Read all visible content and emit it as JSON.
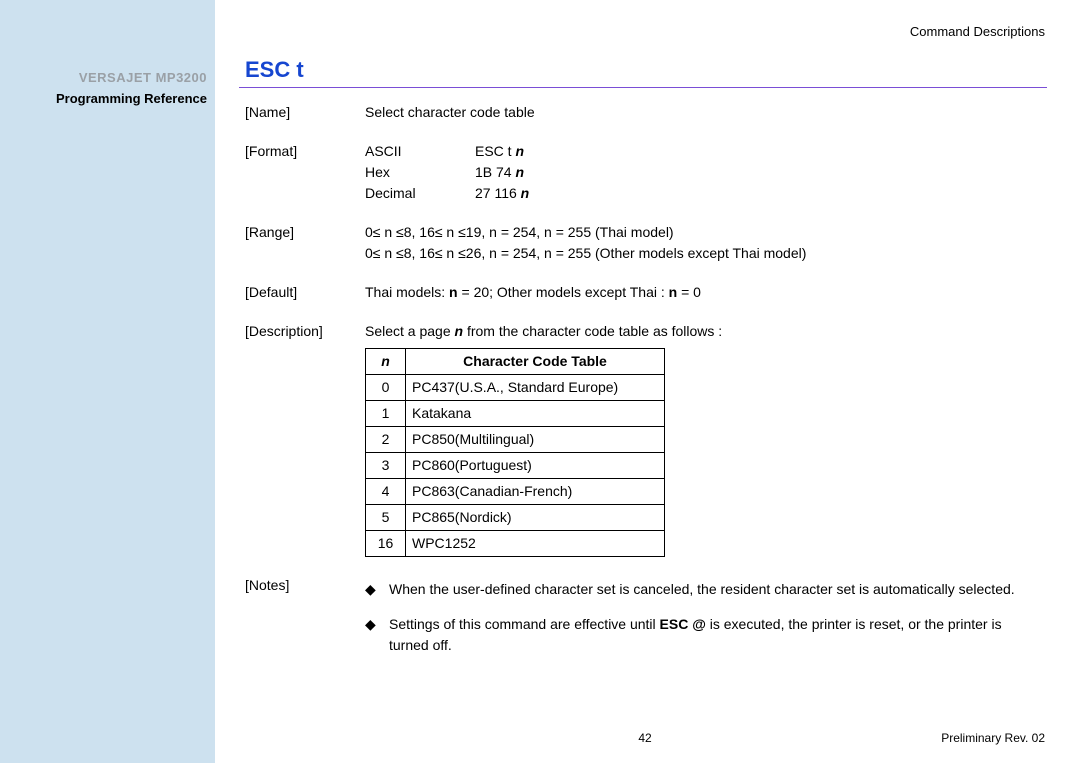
{
  "sidebar": {
    "product": "VERSAJET MP3200",
    "docname": "Programming Reference"
  },
  "header": {
    "section": "Command  Descriptions"
  },
  "command": {
    "title": "ESC t",
    "name_label": "[Name]",
    "name_value": "Select character code table",
    "format_label": "[Format]",
    "format": {
      "ascii_l": "ASCII",
      "ascii_v": "ESC t ",
      "hex_l": "Hex",
      "hex_v": "1B 74 ",
      "dec_l": "Decimal",
      "dec_v": "27 116 ",
      "n": "n"
    },
    "range_label": "[Range]",
    "range": {
      "line1": "0≤ n ≤8, 16≤ n ≤19, n = 254, n = 255 (Thai model)",
      "line2": "0≤ n ≤8, 16≤ n ≤26, n = 254, n = 255 (Other models except Thai model)"
    },
    "default_label": "[Default]",
    "default_before": "Thai models: ",
    "default_mid": " = 20; Other models except Thai : ",
    "default_after": " = 0",
    "description_label": "[Description]",
    "description_before": "Select a page ",
    "description_after": " from the character code table as follows :",
    "table": {
      "h1": "n",
      "h2": "Character Code Table",
      "rows": [
        {
          "n": "0",
          "v": "PC437(U.S.A., Standard Europe)"
        },
        {
          "n": "1",
          "v": "Katakana"
        },
        {
          "n": "2",
          "v": "PC850(Multilingual)"
        },
        {
          "n": "3",
          "v": "PC860(Portuguest)"
        },
        {
          "n": "4",
          "v": "PC863(Canadian-French)"
        },
        {
          "n": "5",
          "v": "PC865(Nordick)"
        },
        {
          "n": "16",
          "v": "WPC1252"
        }
      ]
    },
    "notes_label": "[Notes]",
    "notes": {
      "item1": "When the user-defined character set is canceled, the resident character set is automatically selected.",
      "item2_before": "Settings of this command are effective until ",
      "item2_cmd": "ESC @",
      "item2_after": " is executed, the printer is reset, or the printer is turned off."
    }
  },
  "footer": {
    "page": "42",
    "rev": "Preliminary Rev. 02"
  }
}
